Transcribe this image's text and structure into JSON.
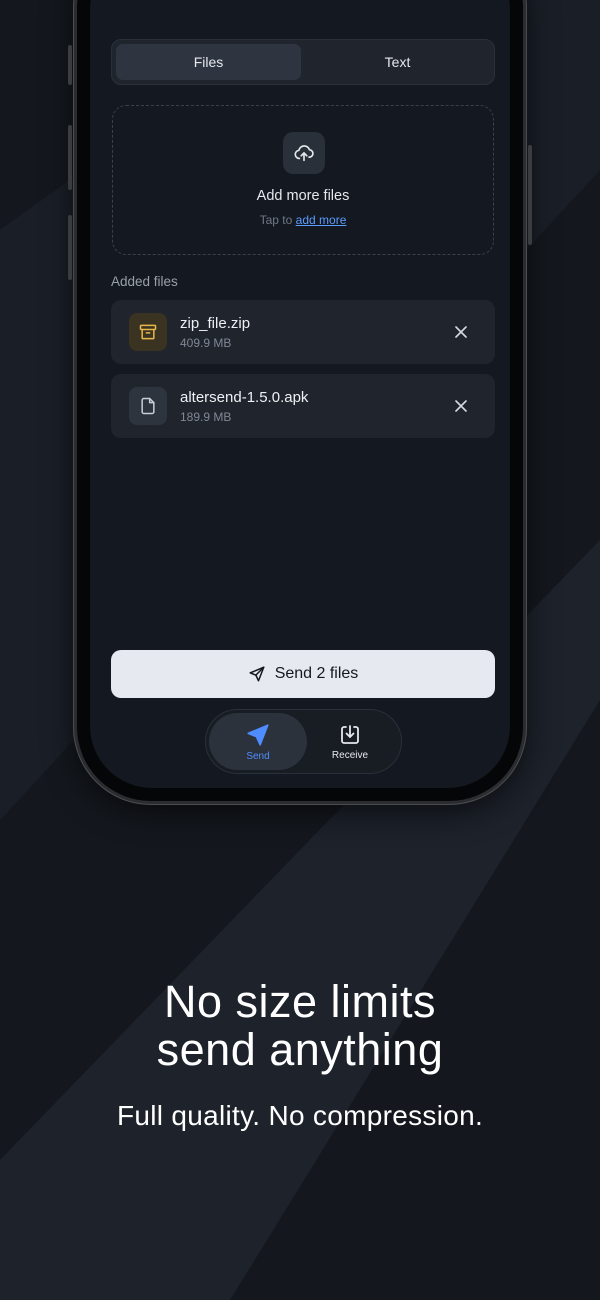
{
  "tabs": [
    {
      "label": "Files",
      "active": true
    },
    {
      "label": "Text",
      "active": false
    }
  ],
  "dropzone": {
    "icon": "cloud-upload-icon",
    "title": "Add more files",
    "hint_prefix": "Tap to",
    "hint_link": "add more"
  },
  "section_label": "Added files",
  "files": [
    {
      "name": "zip_file.zip",
      "size": "409.9 MB",
      "icon": "archive-icon",
      "icon_color": "#e8b64a"
    },
    {
      "name": "altersend-1.5.0.apk",
      "size": "189.9 MB",
      "icon": "file-icon",
      "icon_color": "#c9ced6"
    }
  ],
  "send_button": {
    "label": "Send 2 files",
    "icon": "send-icon"
  },
  "nav": [
    {
      "label": "Send",
      "icon": "send-icon",
      "active": true
    },
    {
      "label": "Receive",
      "icon": "download-icon",
      "active": false
    }
  ],
  "marketing": {
    "headline_line1": "No size limits",
    "headline_line2": "send anything",
    "subline": "Full quality. No compression."
  },
  "colors": {
    "background": "#14181e",
    "screen": "#141820",
    "card": "#1f242d",
    "accent": "#4f8cff",
    "link": "#5b9cff",
    "archive_icon": "#e8b64a",
    "send_button_bg": "#e6e9ef"
  }
}
